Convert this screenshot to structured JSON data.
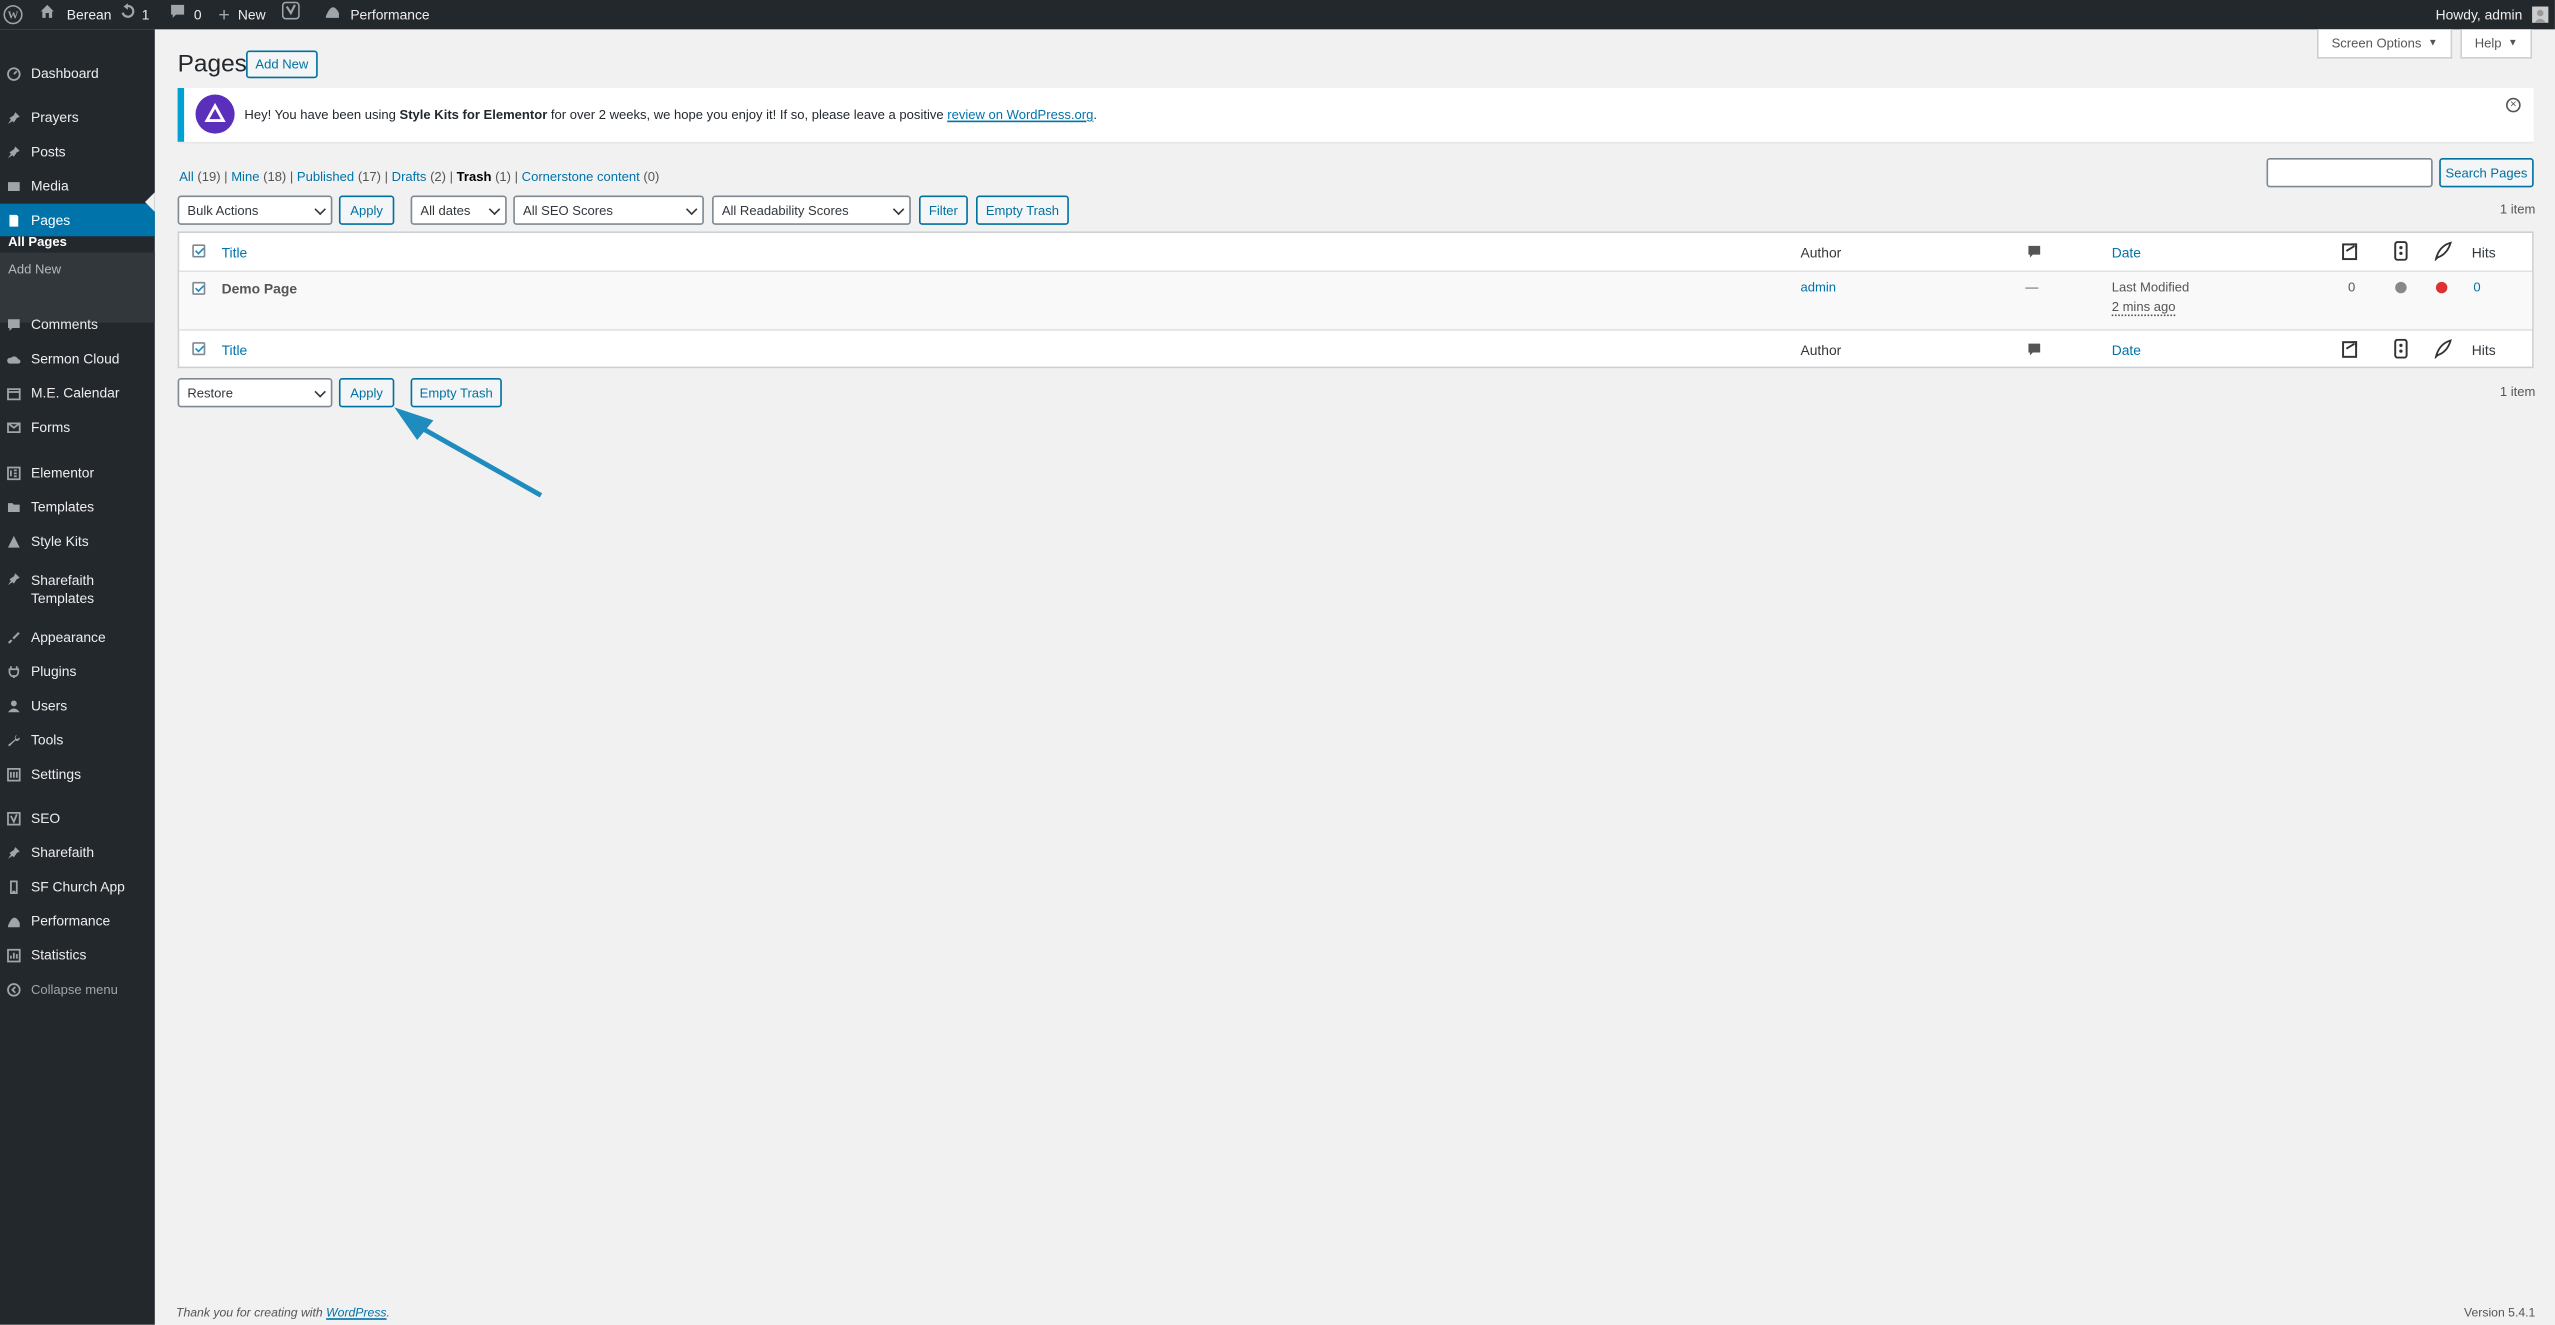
{
  "admin_bar": {
    "site_name": "Berean",
    "updates_count": "1",
    "comments_count": "0",
    "new_label": "New",
    "performance_label": "Performance",
    "howdy": "Howdy, admin"
  },
  "sidebar": {
    "items": [
      {
        "label": "Dashboard",
        "icon": "dashboard-icon"
      },
      {
        "label": "Prayers",
        "icon": "pin-icon"
      },
      {
        "label": "Posts",
        "icon": "pin-icon"
      },
      {
        "label": "Media",
        "icon": "media-icon"
      },
      {
        "label": "Pages",
        "icon": "pages-icon"
      },
      {
        "label": "Comments",
        "icon": "comment-icon"
      },
      {
        "label": "Sermon Cloud",
        "icon": "cloud-icon"
      },
      {
        "label": "M.E. Calendar",
        "icon": "calendar-icon"
      },
      {
        "label": "Forms",
        "icon": "mail-icon"
      },
      {
        "label": "Elementor",
        "icon": "elementor-icon"
      },
      {
        "label": "Templates",
        "icon": "folder-icon"
      },
      {
        "label": "Style Kits",
        "icon": "triangle-icon"
      },
      {
        "label": "Sharefaith",
        "label2": "Templates",
        "icon": "pin-icon"
      },
      {
        "label": "Appearance",
        "icon": "brush-icon"
      },
      {
        "label": "Plugins",
        "icon": "plugin-icon"
      },
      {
        "label": "Users",
        "icon": "user-icon"
      },
      {
        "label": "Tools",
        "icon": "wrench-icon"
      },
      {
        "label": "Settings",
        "icon": "settings-icon"
      },
      {
        "label": "SEO",
        "icon": "yoast-icon"
      },
      {
        "label": "Sharefaith",
        "icon": "pin-icon"
      },
      {
        "label": "SF Church App",
        "icon": "phone-icon"
      },
      {
        "label": "Performance",
        "icon": "performance-icon"
      },
      {
        "label": "Statistics",
        "icon": "chart-icon"
      },
      {
        "label": "Collapse menu",
        "icon": "collapse-icon"
      }
    ],
    "submenu": {
      "all_pages": "All Pages",
      "add_new": "Add New"
    }
  },
  "header": {
    "title": "Pages",
    "add_new": "Add New",
    "screen_options": "Screen Options",
    "help": "Help"
  },
  "notice": {
    "text_before": "Hey! You have been using ",
    "bold": "Style Kits for Elementor",
    "text_after": " for over 2 weeks, we hope you enjoy it! If so, please leave a positive ",
    "link": "review on WordPress.org",
    "end": "."
  },
  "filters": {
    "all": "All",
    "all_count": "(19)",
    "mine": "Mine",
    "mine_count": "(18)",
    "published": "Published",
    "published_count": "(17)",
    "drafts": "Drafts",
    "drafts_count": "(2)",
    "trash": "Trash",
    "trash_count": "(1)",
    "cornerstone": "Cornerstone content",
    "cornerstone_count": "(0)"
  },
  "search": {
    "button": "Search Pages",
    "value": ""
  },
  "top_nav": {
    "bulk_actions": "Bulk Actions",
    "apply": "Apply",
    "dates": "All dates",
    "seo": "All SEO Scores",
    "readability": "All Readability Scores",
    "filter": "Filter",
    "empty_trash": "Empty Trash",
    "item_count": "1 item"
  },
  "table": {
    "columns": {
      "title": "Title",
      "author": "Author",
      "date": "Date",
      "hits": "Hits"
    },
    "row": {
      "title": "Demo Page",
      "author": "admin",
      "comments": "—",
      "date_status": "Last Modified",
      "date_value": "2 mins ago",
      "links_count": "0",
      "seo_color": "#888888",
      "readability_color": "#dc3232",
      "hits": "0"
    }
  },
  "bottom_nav": {
    "action": "Restore",
    "apply": "Apply",
    "empty_trash": "Empty Trash",
    "item_count": "1 item"
  },
  "footer": {
    "thanks": "Thank you for creating with ",
    "wp_link": "WordPress",
    "end": ".",
    "version": "Version 5.4.1"
  },
  "colors": {
    "accent": "#0073aa",
    "sidebar": "#23282d",
    "arrow": "#1e8cbe"
  }
}
